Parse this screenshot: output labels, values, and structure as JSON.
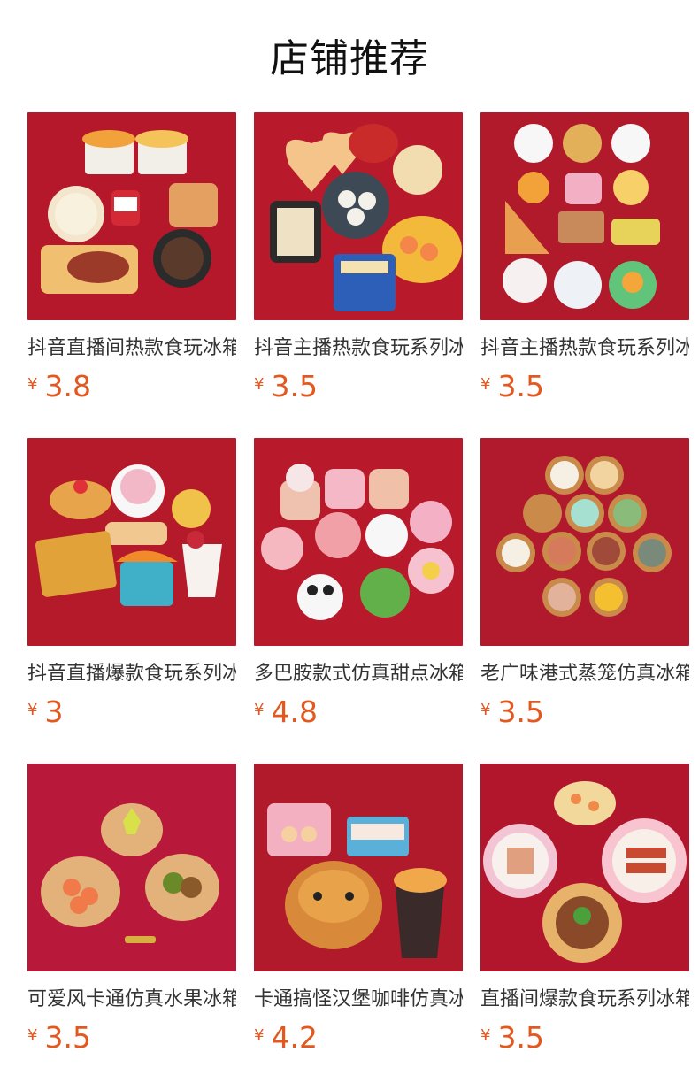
{
  "header": {
    "title": "店铺推荐"
  },
  "colors": {
    "price": "#e1591f",
    "title_text": "#333333"
  },
  "products": [
    {
      "title": "抖音直播间热款食玩冰箱贴",
      "currency": "¥",
      "price": "3.8",
      "image": "food-toys-baskets-drinks-steak-board"
    },
    {
      "title": "抖音主播热款食玩系列冰箱贴",
      "currency": "¥",
      "price": "3.5",
      "image": "food-toys-hearts-dumplings-pineapple-plate"
    },
    {
      "title": "抖音主播热款食玩系列冰箱贴",
      "currency": "¥",
      "price": "3.5",
      "image": "food-toys-plates-cat-waffle-sandwich"
    },
    {
      "title": "抖音直播爆款食玩系列冰箱贴",
      "currency": "¥",
      "price": "3",
      "image": "food-toys-croissant-waffle-cookie-cup"
    },
    {
      "title": "多巴胺款式仿真甜点冰箱贴",
      "currency": "¥",
      "price": "4.8",
      "image": "dessert-cakes-panda-flower"
    },
    {
      "title": "老广味港式蒸笼仿真冰箱贴",
      "currency": "¥",
      "price": "3.5",
      "image": "dim-sum-steamer-baskets-hexagon"
    },
    {
      "title": "可爱风卡通仿真水果冰箱贴",
      "currency": "¥",
      "price": "3.5",
      "image": "cartoon-fruit-boards"
    },
    {
      "title": "卡通搞怪汉堡咖啡仿真冰箱贴",
      "currency": "¥",
      "price": "4.2",
      "image": "cartoon-burger-coffee-eggs"
    },
    {
      "title": "直播间爆款食玩系列冰箱贴",
      "currency": "¥",
      "price": "3.5",
      "image": "food-plates-pancakes-skewers"
    }
  ]
}
